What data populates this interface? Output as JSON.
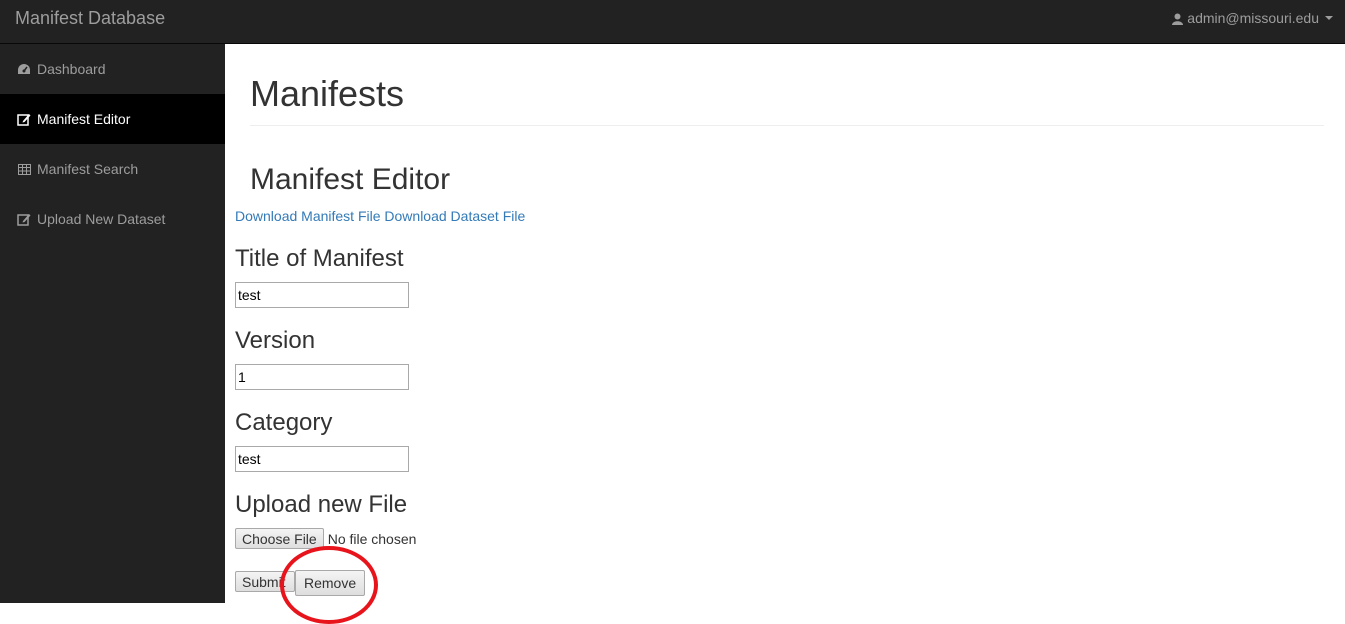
{
  "navbar": {
    "brand": "Manifest Database",
    "user_email": "admin@missouri.edu",
    "user_icon": "user-icon",
    "caret_icon": "caret-down-icon"
  },
  "sidebar": {
    "items": [
      {
        "label": "Dashboard",
        "icon": "dashboard-icon",
        "active": false
      },
      {
        "label": "Manifest Editor",
        "icon": "edit-icon",
        "active": true
      },
      {
        "label": "Manifest Search",
        "icon": "table-icon",
        "active": false
      },
      {
        "label": "Upload New Dataset",
        "icon": "edit-icon",
        "active": false
      }
    ]
  },
  "main": {
    "page_title": "Manifests",
    "editor_title": "Manifest Editor",
    "links": {
      "download_manifest": "Download Manifest File",
      "download_dataset": "Download Dataset File"
    },
    "form": {
      "title_label": "Title of Manifest",
      "title_value": "test",
      "version_label": "Version",
      "version_value": "1",
      "category_label": "Category",
      "category_value": "test",
      "upload_label": "Upload new File",
      "choose_file_label": "Choose File",
      "file_status": "No file chosen",
      "submit_label": "Submit",
      "remove_label": "Remove"
    }
  },
  "colors": {
    "navbar_bg": "#222222",
    "sidebar_active_bg": "#000000",
    "link": "#337ab7",
    "annotation": "#e8141c"
  }
}
